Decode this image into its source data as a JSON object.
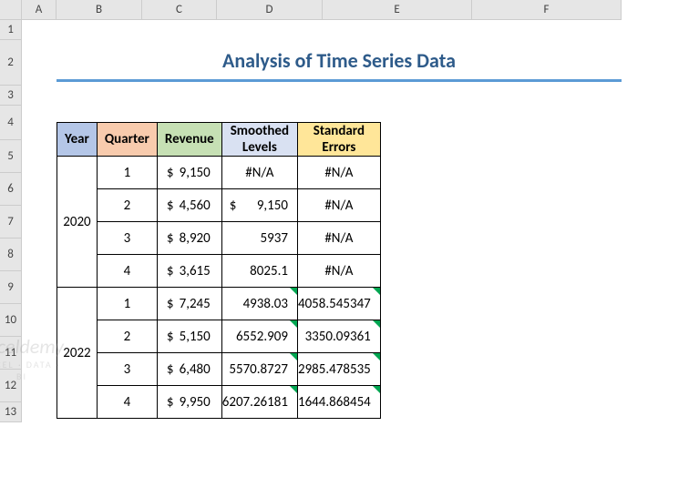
{
  "columns": [
    "A",
    "B",
    "C",
    "D",
    "E",
    "F"
  ],
  "rows": [
    "1",
    "2",
    "3",
    "4",
    "5",
    "6",
    "7",
    "8",
    "9",
    "10",
    "11",
    "12",
    "13"
  ],
  "title": "Analysis of Time Series Data",
  "headers": {
    "year": "Year",
    "quarter": "Quarter",
    "revenue": "Revenue",
    "smoothed": "Smoothed Levels",
    "errors": "Standard Errors"
  },
  "data": {
    "years": [
      "2020",
      "2022"
    ],
    "rows": [
      {
        "q": "1",
        "rev": "9,150",
        "sm": "#N/A",
        "sm_align": "center",
        "err": "#N/A",
        "err_align": "center"
      },
      {
        "q": "2",
        "rev": "4,560",
        "sm": "9,150",
        "sm_dollar": true,
        "sm_align": "right",
        "err": "#N/A",
        "err_align": "center"
      },
      {
        "q": "3",
        "rev": "8,920",
        "sm": "5937",
        "sm_align": "right",
        "err": "#N/A",
        "err_align": "center"
      },
      {
        "q": "4",
        "rev": "3,615",
        "sm": "8025.1",
        "sm_align": "right",
        "err": "#N/A",
        "err_align": "center"
      },
      {
        "q": "1",
        "rev": "7,245",
        "sm": "4938.03",
        "sm_align": "right",
        "sm_tri": true,
        "err": "4058.545347",
        "err_align": "right",
        "err_tri": true
      },
      {
        "q": "2",
        "rev": "5,150",
        "sm": "6552.909",
        "sm_align": "right",
        "sm_tri": true,
        "err": "3350.09361",
        "err_align": "right",
        "err_tri": true
      },
      {
        "q": "3",
        "rev": "6,480",
        "sm": "5570.8727",
        "sm_align": "right",
        "sm_tri": true,
        "err": "2985.478535",
        "err_align": "right",
        "err_tri": true
      },
      {
        "q": "4",
        "rev": "9,950",
        "sm": "6207.26181",
        "sm_align": "right",
        "sm_tri": true,
        "err": "1644.868454",
        "err_align": "right",
        "err_tri": true
      }
    ]
  },
  "watermark": {
    "main": "exceldemy",
    "sub": "EXCEL · DATA · BI"
  },
  "chart_data": {
    "type": "table",
    "title": "Analysis of Time Series Data",
    "columns": [
      "Year",
      "Quarter",
      "Revenue",
      "Smoothed Levels",
      "Standard Errors"
    ],
    "rows": [
      [
        2020,
        1,
        9150,
        null,
        null
      ],
      [
        2020,
        2,
        4560,
        9150,
        null
      ],
      [
        2020,
        3,
        8920,
        5937,
        null
      ],
      [
        2020,
        4,
        3615,
        8025.1,
        null
      ],
      [
        2022,
        1,
        7245,
        4938.03,
        4058.545347
      ],
      [
        2022,
        2,
        5150,
        6552.909,
        3350.09361
      ],
      [
        2022,
        3,
        6480,
        5570.8727,
        2985.478535
      ],
      [
        2022,
        4,
        9950,
        6207.26181,
        1644.868454
      ]
    ]
  }
}
